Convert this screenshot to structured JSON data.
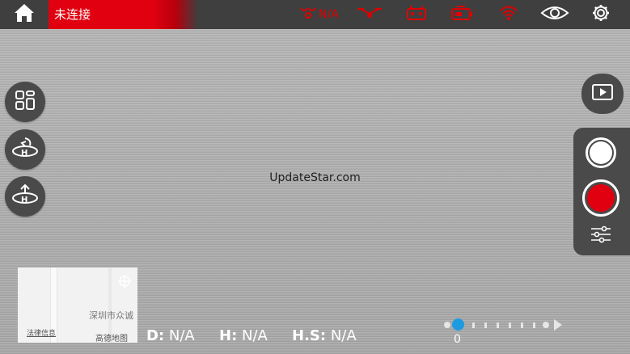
{
  "topbar": {
    "connection_status": "未连接",
    "signal_na_label": "N/A",
    "icons": [
      "home-icon",
      "drone-signal-icon",
      "gimbal-icon",
      "rc-icon",
      "battery-icon",
      "wifi-icon",
      "eye-icon",
      "gear-icon"
    ]
  },
  "left_buttons": [
    "layout-grid-icon",
    "return-home-icon",
    "takeoff-icon"
  ],
  "right_buttons": [
    "playback-icon",
    "photo-shutter",
    "record-button",
    "camera-settings-icon"
  ],
  "watermark": "UpdateStar.com",
  "map": {
    "city_label": "深圳市众诚",
    "legal_link": "法律信息",
    "brand": "高德地图"
  },
  "telemetry": {
    "d_label": "D:",
    "d_value": "N/A",
    "h_label": "H:",
    "h_value": "N/A",
    "hs_label": "H.S:",
    "hs_value": "N/A"
  },
  "timeline": {
    "value_label": "0"
  },
  "colors": {
    "accent_red": "#e00010",
    "slider_blue": "#1e9be0",
    "bar_dark": "#3f3f3f"
  }
}
